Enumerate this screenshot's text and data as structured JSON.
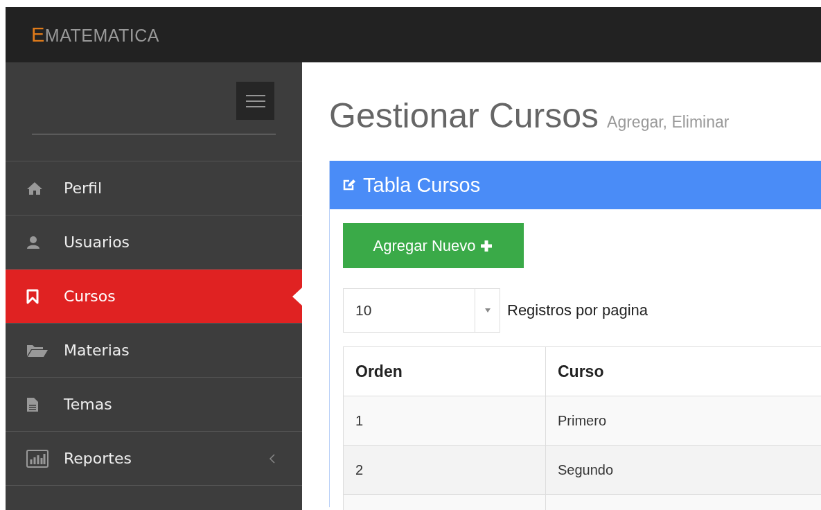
{
  "logo": {
    "initial": "E",
    "rest": "MATEMATICA"
  },
  "sidebar": {
    "items": [
      {
        "label": "Perfil",
        "kind": "link",
        "selected": false
      },
      {
        "label": "Usuarios",
        "kind": "link",
        "selected": false
      },
      {
        "label": "Cursos",
        "kind": "link",
        "selected": true
      },
      {
        "label": "Materias",
        "kind": "link",
        "selected": false
      },
      {
        "label": "Temas",
        "kind": "link",
        "selected": false
      },
      {
        "label": "Reportes",
        "kind": "group",
        "selected": false
      }
    ]
  },
  "page": {
    "title": "Gestionar Cursos",
    "subtitle": "Agregar, Eliminar"
  },
  "panel": {
    "title": "Tabla Cursos",
    "add_button": "Agregar Nuevo",
    "page_size": {
      "value": "10",
      "label": "Registros por pagina"
    },
    "table": {
      "columns": [
        "Orden",
        "Curso"
      ],
      "rows": [
        [
          "1",
          "Primero"
        ],
        [
          "2",
          "Segundo"
        ]
      ]
    }
  }
}
